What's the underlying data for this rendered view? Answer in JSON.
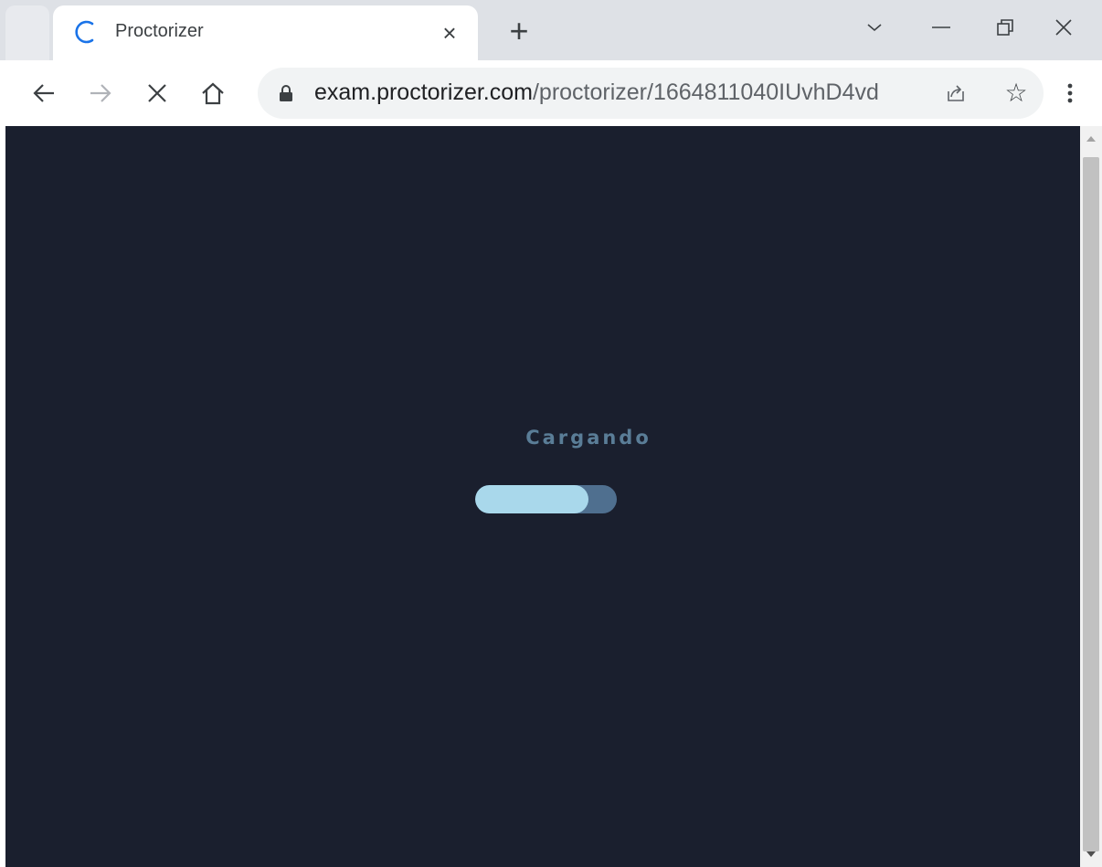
{
  "browser": {
    "tab": {
      "title": "Proctorizer",
      "close_glyph": "×",
      "favicon": "loading-spinner-icon"
    },
    "new_tab_glyph": "+",
    "window_controls": [
      "tab-search-icon",
      "minimize-icon",
      "restore-icon",
      "close-icon"
    ],
    "toolbar": {
      "nav_icons": [
        "back-arrow-icon",
        "forward-arrow-icon",
        "stop-loading-icon",
        "home-icon"
      ],
      "url_host": "exam.proctorizer.com",
      "url_path": "/proctorizer/1664811040IUvhD4vd",
      "star_glyph": "☆",
      "menu_icon": "kebab-menu-icon"
    }
  },
  "page": {
    "loading_text": "Cargando",
    "progress_fraction": 0.8
  },
  "colors": {
    "background": "#1a1f2e",
    "loading_text": "#5a7d97",
    "progress_track": "#4f6f8f",
    "progress_fill": "#a9d8eb",
    "spinner": "#1a73e8"
  }
}
